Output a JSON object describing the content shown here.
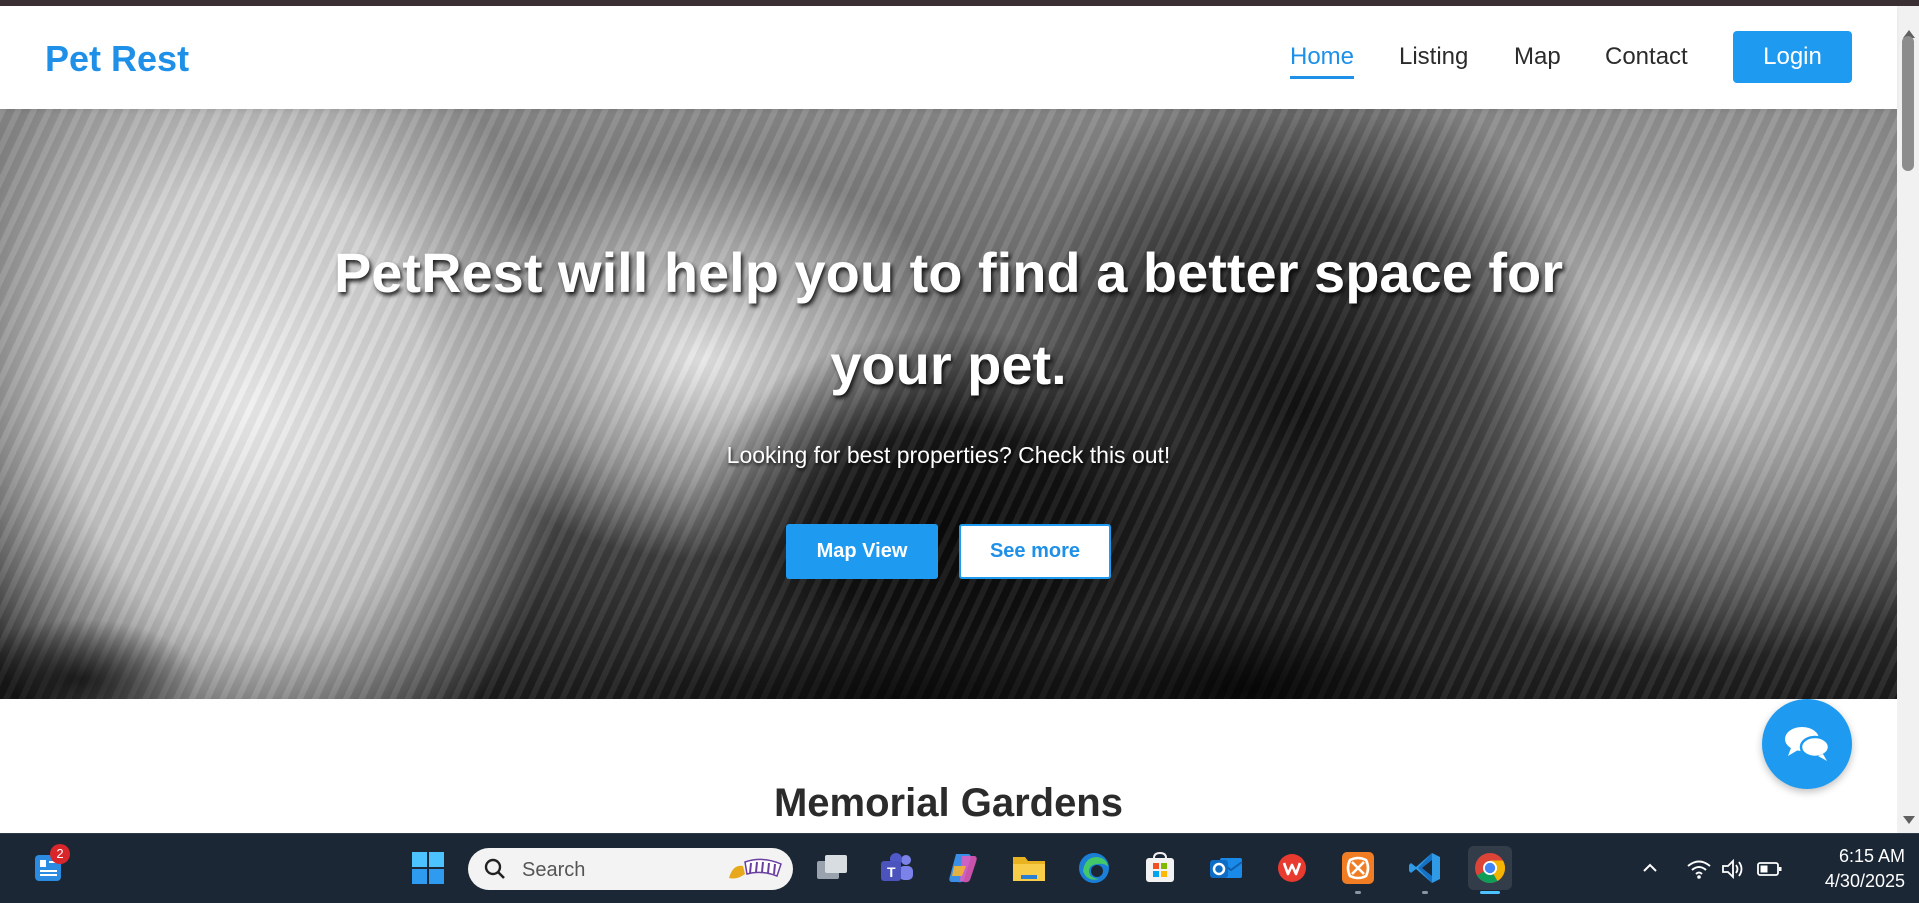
{
  "navbar": {
    "brand": "Pet Rest",
    "links": [
      "Home",
      "Listing",
      "Map",
      "Contact"
    ],
    "active_link": "Home",
    "login_label": "Login"
  },
  "hero": {
    "title": "PetRest will help you to find a better space for your pet.",
    "subtitle": "Looking for best properties? Check this out!",
    "map_view_label": "Map View",
    "see_more_label": "See more"
  },
  "section": {
    "title": "Memorial Gardens"
  },
  "chat": {
    "icon": "chat-bubbles-icon"
  },
  "taskbar": {
    "widgets_badge": "2",
    "search_placeholder": "Search",
    "apps": [
      "start-icon",
      "search",
      "task-view-icon",
      "teams-icon",
      "copilot-icon",
      "file-explorer-icon",
      "edge-icon",
      "store-icon",
      "outlook-icon",
      "wps-icon",
      "xampp-icon",
      "vscode-icon",
      "chrome-icon"
    ],
    "time": "6:15 AM",
    "date": "4/30/2025"
  },
  "colors": {
    "accent": "#1e9af0",
    "brand": "#1e90e8",
    "taskbar": "#1c2736"
  }
}
